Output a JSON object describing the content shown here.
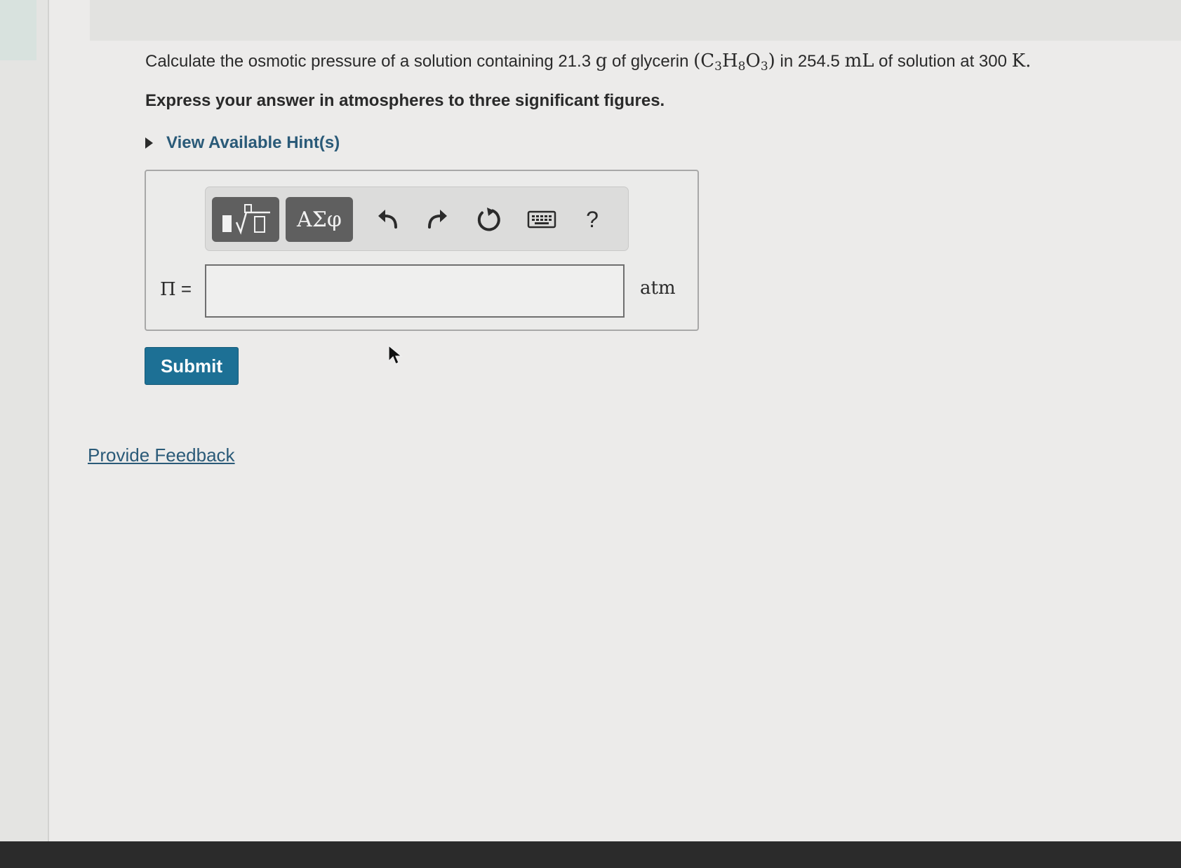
{
  "question": {
    "text_before_mass": "Calculate the osmotic pressure of a solution containing 21.3 ",
    "mass_unit": "g",
    "text_after_mass": " of glycerin ",
    "formula_open": "(",
    "formula_c": "C",
    "formula_c_sub": "3",
    "formula_h": "H",
    "formula_h_sub": "8",
    "formula_o": "O",
    "formula_o_sub": "3",
    "formula_close": ")",
    "text_in": " in 254.5 ",
    "volume_unit": "mL",
    "text_of_solution": " of solution at 300 ",
    "temp_unit": "K",
    "period": "."
  },
  "instruction": "Express your answer in atmospheres to three significant figures.",
  "hints": {
    "label": "View Available Hint(s)"
  },
  "toolbar": {
    "symbols_label": "ΑΣφ",
    "help_label": "?"
  },
  "answer": {
    "variable": "Π",
    "equals": " =",
    "value": "",
    "unit": "atm"
  },
  "submit_label": "Submit",
  "feedback_label": "Provide Feedback",
  "colors": {
    "submit_bg": "#1d7095",
    "link": "#2a5a78",
    "toolbar_dark_button": "#5f5f5f"
  },
  "icons": [
    "caret-right-icon",
    "templates-icon",
    "undo-icon",
    "redo-icon",
    "reset-icon",
    "keyboard-icon",
    "help-icon",
    "mouse-pointer-icon"
  ]
}
